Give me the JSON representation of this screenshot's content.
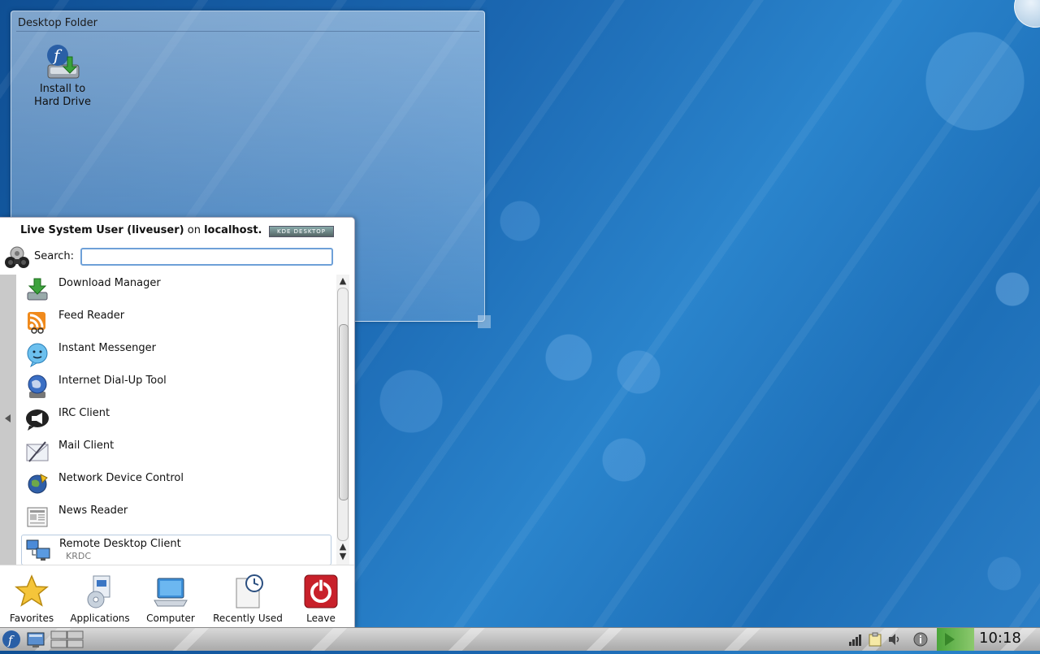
{
  "desktop": {
    "folder_title": "Desktop Folder",
    "icons": [
      {
        "label_line1": "Install to",
        "label_line2": "Hard Drive"
      }
    ]
  },
  "kickoff": {
    "user_name": "Live System User (liveuser)",
    "on_text": "on",
    "host": "localhost.",
    "badge": "KDE DESKTOP",
    "search_label": "Search:",
    "search_value": "",
    "items": [
      {
        "label": "Download Manager"
      },
      {
        "label": "Feed Reader"
      },
      {
        "label": "Instant Messenger"
      },
      {
        "label": "Internet Dial-Up Tool"
      },
      {
        "label": "IRC Client"
      },
      {
        "label": "Mail Client"
      },
      {
        "label": "Network Device Control"
      },
      {
        "label": "News Reader"
      },
      {
        "label": "Remote Desktop Client",
        "sub": "KRDC"
      }
    ],
    "tabs": [
      {
        "label": "Favorites"
      },
      {
        "label": "Applications"
      },
      {
        "label": "Computer"
      },
      {
        "label": "Recently Used"
      },
      {
        "label": "Leave"
      }
    ]
  },
  "taskbar": {
    "clock": "10:18"
  },
  "colors": {
    "accent_focus": "#6ea0d8",
    "leave_red": "#c8202a",
    "tray_green": "#4aa43a"
  }
}
